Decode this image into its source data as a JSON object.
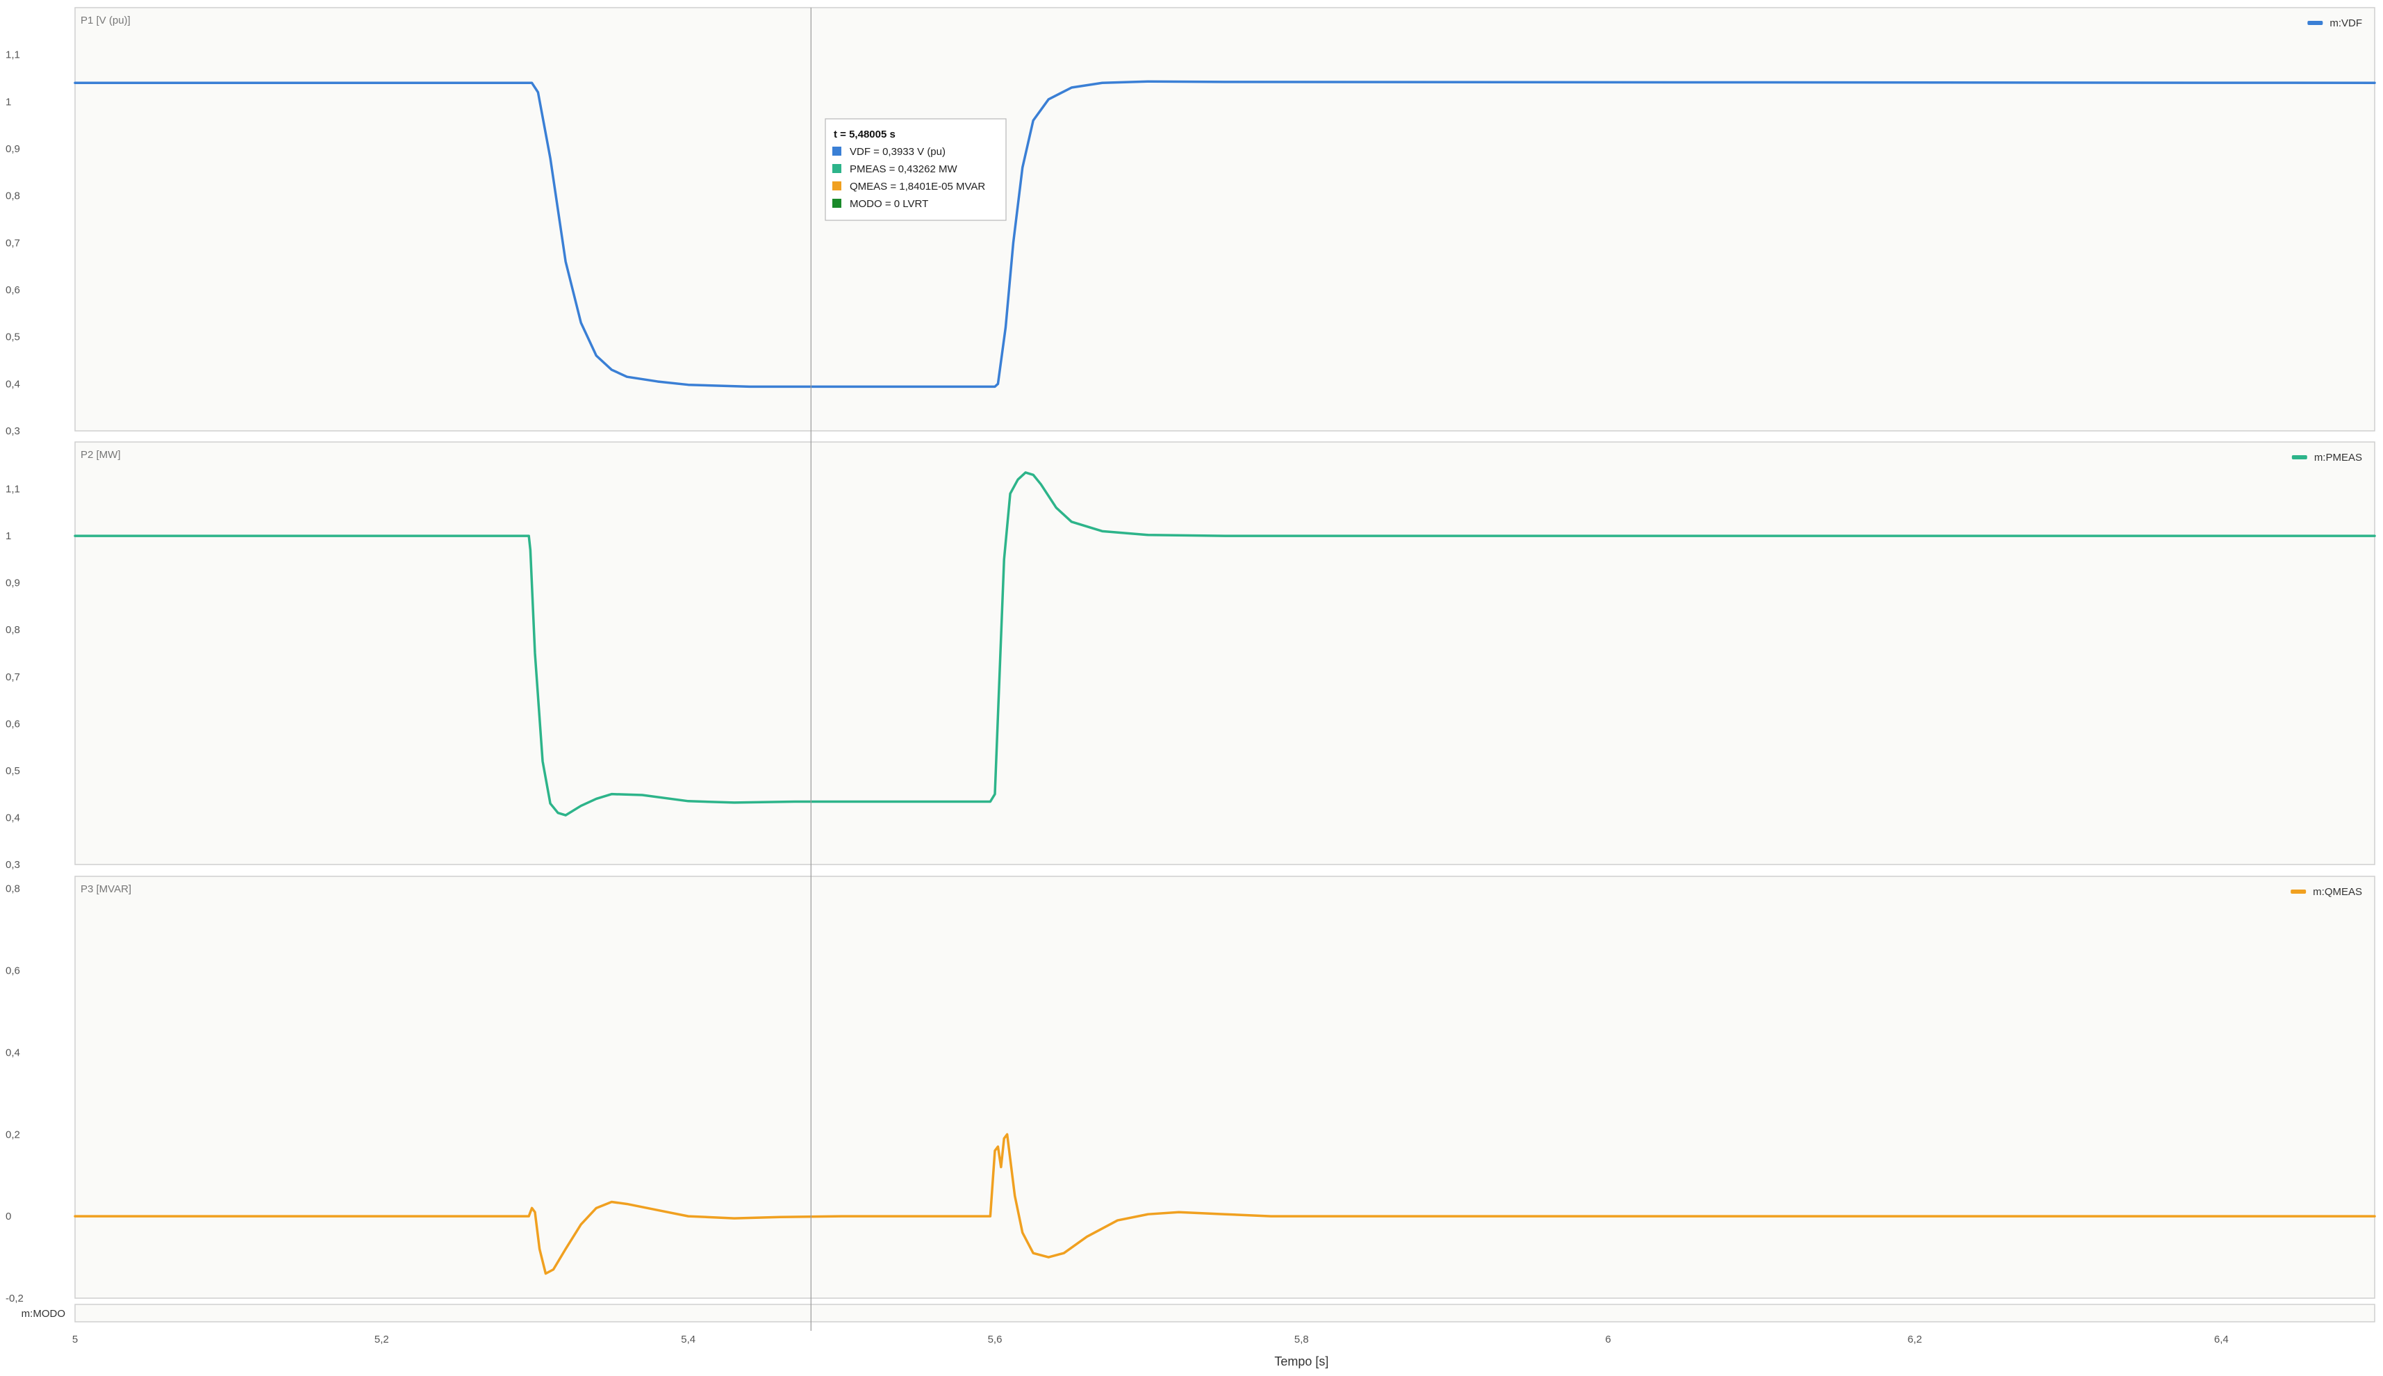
{
  "chart_data": {
    "type": "line",
    "xlabel": "Tempo [s]",
    "xlim": [
      5.0,
      6.5
    ],
    "xticks": [
      5,
      5.2,
      5.4,
      5.6,
      5.8,
      6,
      6.2,
      6.4
    ],
    "xtick_labels": [
      "5",
      "5,2",
      "5,4",
      "5,6",
      "5,8",
      "6",
      "6,2",
      "6,4"
    ],
    "cursor_x": 5.48005,
    "panels": [
      {
        "id": "p1",
        "title": "P1 [V (pu)]",
        "ylim": [
          0.3,
          1.2
        ],
        "yticks": [
          0.3,
          0.4,
          0.5,
          0.6,
          0.7,
          0.8,
          0.9,
          1.0,
          1.1
        ],
        "ytick_labels": [
          "0,3",
          "0,4",
          "0,5",
          "0,6",
          "0,7",
          "0,8",
          "0,9",
          "1",
          "1,1"
        ],
        "series": [
          {
            "name": "m:VDF",
            "color": "#3a7fd5",
            "points": [
              [
                5.0,
                1.04
              ],
              [
                5.298,
                1.04
              ],
              [
                5.302,
                1.02
              ],
              [
                5.31,
                0.88
              ],
              [
                5.32,
                0.66
              ],
              [
                5.33,
                0.53
              ],
              [
                5.34,
                0.46
              ],
              [
                5.35,
                0.43
              ],
              [
                5.36,
                0.415
              ],
              [
                5.38,
                0.405
              ],
              [
                5.4,
                0.398
              ],
              [
                5.44,
                0.394
              ],
              [
                5.5,
                0.394
              ],
              [
                5.6,
                0.394
              ],
              [
                5.6,
                0.394
              ],
              [
                5.602,
                0.4
              ],
              [
                5.607,
                0.52
              ],
              [
                5.612,
                0.7
              ],
              [
                5.618,
                0.86
              ],
              [
                5.625,
                0.96
              ],
              [
                5.635,
                1.005
              ],
              [
                5.65,
                1.03
              ],
              [
                5.67,
                1.04
              ],
              [
                5.7,
                1.043
              ],
              [
                5.75,
                1.042
              ],
              [
                6.5,
                1.04
              ]
            ]
          }
        ]
      },
      {
        "id": "p2",
        "title": "P2 [MW]",
        "ylim": [
          0.3,
          1.2
        ],
        "yticks": [
          0.3,
          0.4,
          0.5,
          0.6,
          0.7,
          0.8,
          0.9,
          1.0,
          1.1
        ],
        "ytick_labels": [
          "0,3",
          "0,4",
          "0,5",
          "0,6",
          "0,7",
          "0,8",
          "0,9",
          "1",
          "1,1"
        ],
        "series": [
          {
            "name": "m:PMEAS",
            "color": "#2db48a",
            "points": [
              [
                5.0,
                1.0
              ],
              [
                5.296,
                1.0
              ],
              [
                5.297,
                0.97
              ],
              [
                5.3,
                0.75
              ],
              [
                5.305,
                0.52
              ],
              [
                5.31,
                0.43
              ],
              [
                5.315,
                0.41
              ],
              [
                5.32,
                0.405
              ],
              [
                5.33,
                0.425
              ],
              [
                5.34,
                0.44
              ],
              [
                5.35,
                0.45
              ],
              [
                5.37,
                0.448
              ],
              [
                5.4,
                0.435
              ],
              [
                5.43,
                0.432
              ],
              [
                5.47,
                0.434
              ],
              [
                5.5,
                0.434
              ],
              [
                5.597,
                0.434
              ],
              [
                5.6,
                0.45
              ],
              [
                5.603,
                0.7
              ],
              [
                5.606,
                0.95
              ],
              [
                5.61,
                1.09
              ],
              [
                5.615,
                1.12
              ],
              [
                5.62,
                1.135
              ],
              [
                5.625,
                1.13
              ],
              [
                5.63,
                1.11
              ],
              [
                5.64,
                1.06
              ],
              [
                5.65,
                1.03
              ],
              [
                5.67,
                1.01
              ],
              [
                5.7,
                1.002
              ],
              [
                5.75,
                1.0
              ],
              [
                6.5,
                1.0
              ]
            ]
          }
        ]
      },
      {
        "id": "p3",
        "title": "P3 [MVAR]",
        "ylim": [
          -0.2,
          0.83
        ],
        "yticks": [
          -0.2,
          0.0,
          0.2,
          0.4,
          0.6,
          0.8
        ],
        "ytick_labels": [
          "-0,2",
          "0",
          "0,2",
          "0,4",
          "0,6",
          "0,8"
        ],
        "series": [
          {
            "name": "m:QMEAS",
            "color": "#f0a020",
            "points": [
              [
                5.0,
                0.0
              ],
              [
                5.296,
                0.0
              ],
              [
                5.298,
                0.02
              ],
              [
                5.3,
                0.01
              ],
              [
                5.303,
                -0.08
              ],
              [
                5.307,
                -0.14
              ],
              [
                5.312,
                -0.13
              ],
              [
                5.32,
                -0.08
              ],
              [
                5.33,
                -0.02
              ],
              [
                5.34,
                0.02
              ],
              [
                5.35,
                0.035
              ],
              [
                5.36,
                0.03
              ],
              [
                5.38,
                0.015
              ],
              [
                5.4,
                0.0
              ],
              [
                5.43,
                -0.005
              ],
              [
                5.46,
                -0.002
              ],
              [
                5.5,
                0.0
              ],
              [
                5.597,
                0.0
              ],
              [
                5.6,
                0.16
              ],
              [
                5.602,
                0.17
              ],
              [
                5.604,
                0.12
              ],
              [
                5.606,
                0.19
              ],
              [
                5.608,
                0.2
              ],
              [
                5.61,
                0.14
              ],
              [
                5.613,
                0.05
              ],
              [
                5.618,
                -0.04
              ],
              [
                5.625,
                -0.09
              ],
              [
                5.635,
                -0.1
              ],
              [
                5.645,
                -0.09
              ],
              [
                5.66,
                -0.05
              ],
              [
                5.68,
                -0.01
              ],
              [
                5.7,
                0.005
              ],
              [
                5.72,
                0.01
              ],
              [
                5.75,
                0.005
              ],
              [
                5.78,
                0.0
              ],
              [
                6.5,
                0.0
              ]
            ]
          }
        ]
      },
      {
        "id": "p4",
        "title": "m:MODO",
        "ylim": [
          0,
          1
        ],
        "series": []
      }
    ],
    "tooltip": {
      "title": "t = 5,48005 s",
      "rows": [
        {
          "text": "VDF = 0,3933 V (pu)",
          "color": "#3a7fd5"
        },
        {
          "text": "PMEAS = 0,43262 MW",
          "color": "#2db48a"
        },
        {
          "text": "QMEAS = 1,8401E-05 MVAR",
          "color": "#f0a020"
        },
        {
          "text": "MODO = 0 LVRT",
          "color": "#1a8a2a"
        }
      ]
    }
  }
}
